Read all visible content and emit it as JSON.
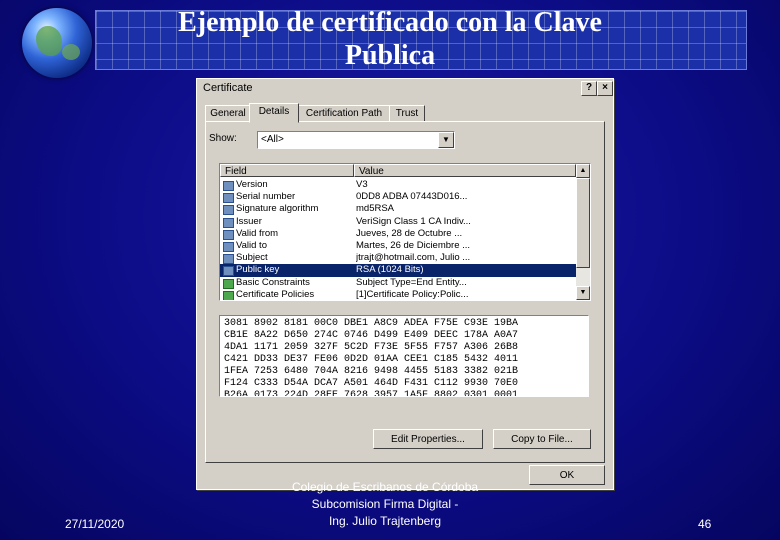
{
  "slide": {
    "title": "Ejemplo de certificado con la Clave\nPública",
    "date": "27/11/2020",
    "footer_lines": [
      "Colegio de Escribanos de Córdoba",
      "Subcomision Firma Digital -",
      "Ing. Julio Trajtenberg"
    ],
    "page_number": "46"
  },
  "dialog": {
    "title": "Certificate",
    "help_button": "?",
    "close_button": "×",
    "tabs": [
      "General",
      "Details",
      "Certification Path",
      "Trust"
    ],
    "active_tab": "Details",
    "show_label": "Show:",
    "show_value": "<All>",
    "columns": [
      "Field",
      "Value"
    ],
    "rows": [
      {
        "field": "Version",
        "value": "V3",
        "icon": "cert-field-icon",
        "selected": false
      },
      {
        "field": "Serial number",
        "value": "0DD8 ADBA 07443D016...",
        "icon": "cert-field-icon",
        "selected": false
      },
      {
        "field": "Signature algorithm",
        "value": "md5RSA",
        "icon": "cert-field-icon",
        "selected": false
      },
      {
        "field": "Issuer",
        "value": "VeriSign Class 1 CA Indiv...",
        "icon": "cert-field-icon",
        "selected": false
      },
      {
        "field": "Valid from",
        "value": "Jueves, 28 de Octubre ...",
        "icon": "cert-field-icon",
        "selected": false
      },
      {
        "field": "Valid to",
        "value": "Martes, 26 de Diciembre ...",
        "icon": "cert-field-icon",
        "selected": false
      },
      {
        "field": "Subject",
        "value": "jtrajt@hotmail.com, Julio ...",
        "icon": "cert-field-icon",
        "selected": false
      },
      {
        "field": "Public key",
        "value": "RSA (1024 Bits)",
        "icon": "cert-field-icon",
        "selected": true
      },
      {
        "field": "Basic Constraints",
        "value": "Subject Type=End Entity...",
        "icon": "cert-extension-icon",
        "selected": false
      },
      {
        "field": "Certificate Policies",
        "value": "[1]Certificate Policy:Polic...",
        "icon": "cert-extension-icon",
        "selected": false
      }
    ],
    "hex_lines": [
      "3081 8902 8181 00C0 DBE1 A8C9 ADEA F75E C93E 19BA",
      "CB1E 8A22 D650 274C 0746 D499 E409 DEEC 178A A0A7",
      "4DA1 1171 2059 327F 5C2D F73E 5F55 F757 A306 26B8",
      "C421 DD33 DE37 FE06 0D2D 01AA CEE1 C185 5432 4011",
      "1FEA 7253 6480 704A 8216 9498 4455 5183 3382 021B",
      "F124 C333 D54A DCA7 A501 464D F431 C112 9930 70E0",
      "B26A 0173 224D 28EE 7628 3957 1A5F 8802 0301 0001"
    ],
    "edit_properties": "Edit Properties...",
    "copy_to_file": "Copy to File...",
    "ok": "OK"
  }
}
